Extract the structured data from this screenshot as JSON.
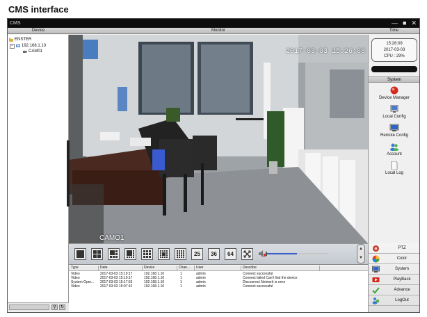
{
  "heading": "CMS interface",
  "window": {
    "title": "CMS",
    "controls": {
      "minimize": "—",
      "maximize": "■",
      "close": "✕"
    }
  },
  "columns": {
    "device": "Device",
    "monitor": "Monitor",
    "time": "Time"
  },
  "device_tree": {
    "root": "ENSTER",
    "ip": "192.168.1.10",
    "channel": "CAM01"
  },
  "video": {
    "osd_time": "2017-03-03 15:26:08",
    "camera_label": "CAMO1"
  },
  "toolbar": {
    "split_buttons": [
      "1",
      "4",
      "6",
      "8",
      "9",
      "13",
      "16",
      "25",
      "36",
      "64"
    ],
    "volume_level": 0.5
  },
  "log": {
    "headers": [
      "Type",
      "Date",
      "Device",
      "Chan...",
      "User",
      "Describe"
    ],
    "rows": [
      [
        "Video",
        "2017-03-03 15:19:17",
        "192.168.1.10",
        "1",
        "admin",
        "Connect successful"
      ],
      [
        "Video",
        "2017-03-03 15:19:17",
        "192.168.1.10",
        "1",
        "admin",
        "Connect failed Can't find the device"
      ],
      [
        "System Oper...",
        "2017-03-03 15:17:53",
        "192.168.1.10",
        "1",
        "admin",
        "Disconnect Network is error"
      ],
      [
        "Video",
        "2017-03-03 15:07:10",
        "192.168.1.10",
        "1",
        "admin",
        "Connect successful"
      ]
    ]
  },
  "clock": {
    "time": "15:26:09",
    "date": "2017-03-03",
    "cpu": "CPU : 29%"
  },
  "system": {
    "title": "System",
    "items": [
      {
        "label": "Device Manager",
        "icon": "device-manager-icon"
      },
      {
        "label": "Local Config",
        "icon": "local-config-icon"
      },
      {
        "label": "Remote Config",
        "icon": "remote-config-icon"
      },
      {
        "label": "Account",
        "icon": "account-icon"
      },
      {
        "label": "Local Log",
        "icon": "local-log-icon"
      }
    ]
  },
  "menu": [
    {
      "label": "PTZ",
      "icon": "ptz-icon"
    },
    {
      "label": "Color",
      "icon": "color-icon"
    },
    {
      "label": "System",
      "icon": "system-icon"
    },
    {
      "label": "PlayBack",
      "icon": "playback-icon"
    },
    {
      "label": "Advance",
      "icon": "advance-icon"
    },
    {
      "label": "LogOut",
      "icon": "logout-icon"
    }
  ],
  "colors": {
    "titlebar": "#0d0d0d",
    "accent_red": "#d42a1e",
    "volume": "#3a5cc8"
  }
}
